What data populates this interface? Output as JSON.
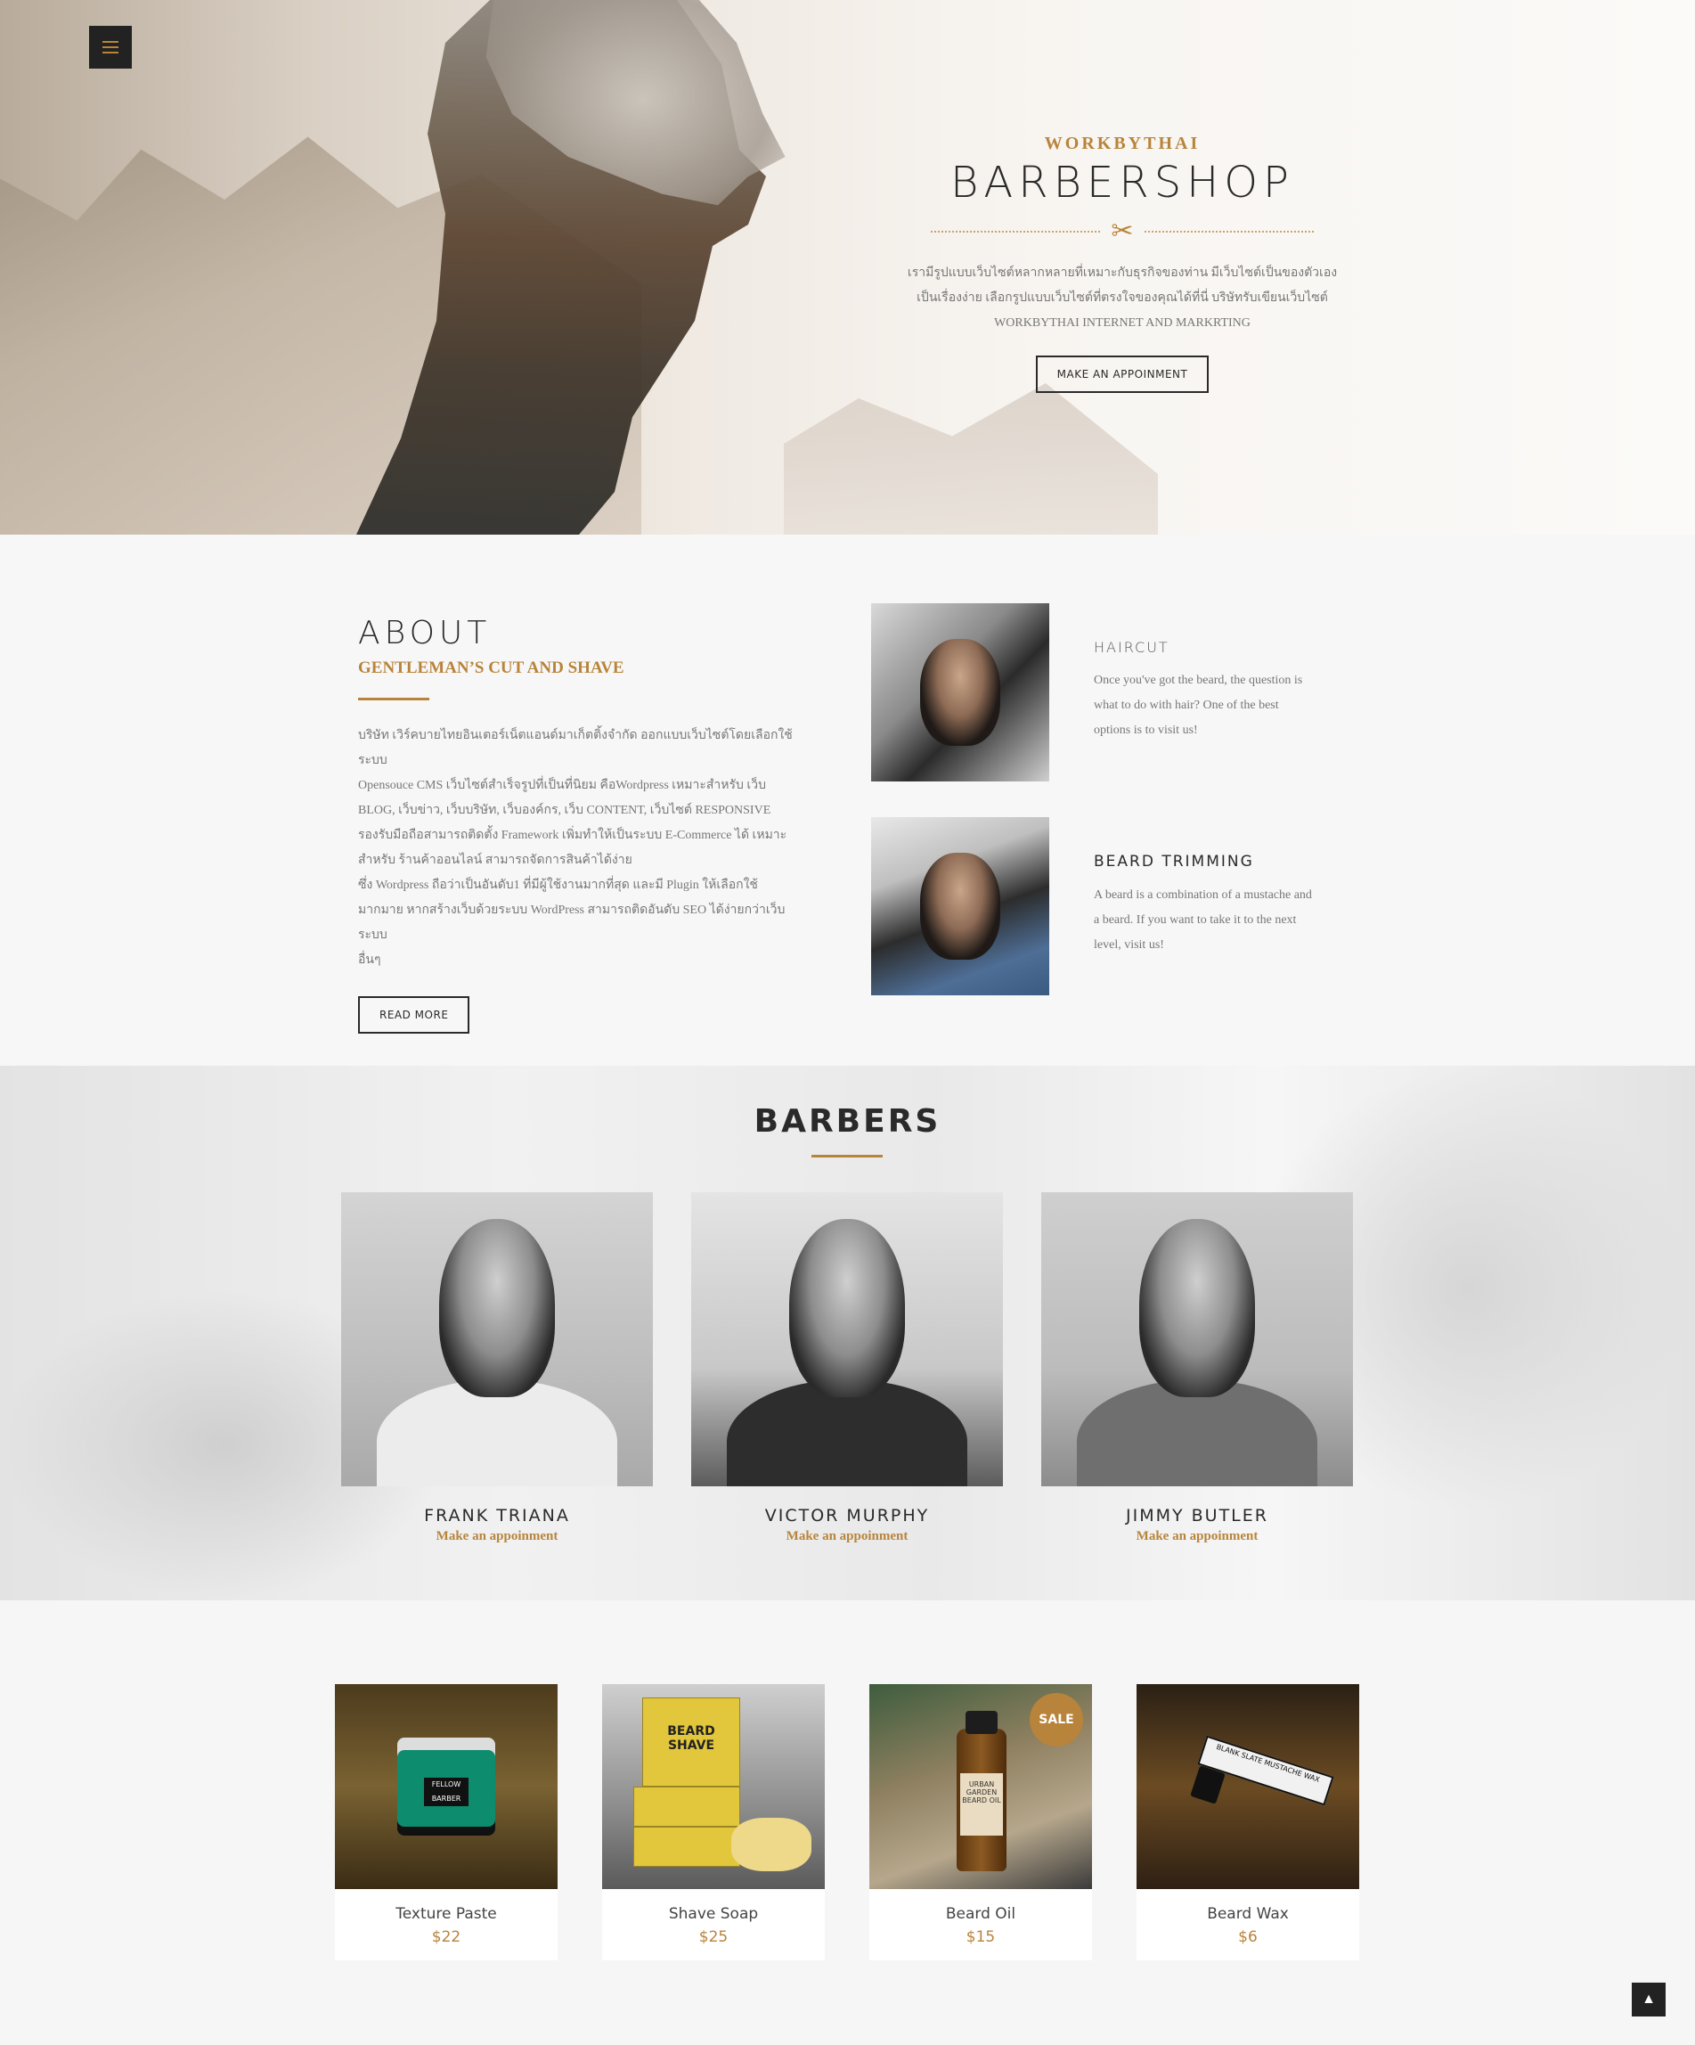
{
  "hero": {
    "brand": "WORKBYTHAI",
    "title": "BARBERSHOP",
    "desc_line1": "เรามีรูปแบบเว็บไซต์หลากหลายที่เหมาะกับธุรกิจของท่าน มีเว็บไซต์เป็นของตัวเอง",
    "desc_line2": "เป็นเรื่องง่าย เลือกรูปแบบเว็บไซต์ที่ตรงใจของคุณได้ที่นี่ บริษัทรับเขียนเว็บไซต์",
    "desc_line3": "WORKBYTHAI INTERNET AND MARKRTING",
    "cta": "MAKE AN APPOINMENT"
  },
  "about": {
    "title": "ABOUT",
    "subtitle": "GENTLEMAN’S CUT AND SHAVE",
    "body_lines": [
      "บริษัท เวิร์คบายไทยอินเตอร์เน็ตแอนด์มาเก็ตติ้งจำกัด ออกแบบเว็บไซต์โดยเลือกใช้ระบบ",
      "Opensouce CMS เว็บไซต์สำเร็จรูปที่เป็นที่นิยม คือWordpress เหมาะสำหรับ เว็บ",
      "BLOG, เว็บข่าว, เว็บบริษัท, เว็บองค์กร, เว็บ CONTENT, เว็บไซต์ RESPONSIVE",
      "รองรับมือถือสามารถติดตั้ง Framework เพิ่มทำให้เป็นระบบ E-Commerce ได้ เหมาะ",
      "สำหรับ ร้านค้าออนไลน์ สามารถจัดการสินค้าได้ง่าย",
      "ซึ่ง Wordpress ถือว่าเป็นอันดับ1 ที่มีผู้ใช้งานมากที่สุด และมี Plugin ให้เลือกใช้",
      "มากมาย หากสร้างเว็บด้วยระบบ WordPress สามารถติดอันดับ SEO ได้ง่ายกว่าเว็บระบบ",
      "อื่นๆ"
    ],
    "read_more": "READ MORE"
  },
  "services": [
    {
      "title": "HAIRCUT",
      "desc_lines": [
        "Once you've got the beard, the question is",
        "what to do with hair? One of the best",
        "options is to visit us!"
      ]
    },
    {
      "title": "BEARD TRIMMING",
      "desc_lines": [
        "A beard is a combination of a mustache and",
        "a beard. If you want to take it to the next",
        "level, visit us!"
      ]
    }
  ],
  "barbers": {
    "title": "BARBERS",
    "items": [
      {
        "name": "FRANK TRIANA",
        "link": "Make an appoinment"
      },
      {
        "name": "VICTOR MURPHY",
        "link": "Make an appoinment"
      },
      {
        "name": "JIMMY BUTLER",
        "link": "Make an appoinment"
      }
    ]
  },
  "products": [
    {
      "name": "Texture Paste",
      "price": "$22",
      "label": "FELLOW BARBER"
    },
    {
      "name": "Shave Soap",
      "price": "$25",
      "label": "BEARD SHAVE"
    },
    {
      "name": "Beard Oil",
      "price": "$15",
      "label": "URBAN GARDEN BEARD OIL",
      "badge": "SALE"
    },
    {
      "name": "Beard Wax",
      "price": "$6",
      "label": "BLANK SLATE MUSTACHE WAX"
    }
  ],
  "icons": {
    "menu": "hamburger-icon",
    "scissors": "scissors-icon",
    "to_top": "chevron-up-icon"
  },
  "colors": {
    "accent": "#b8843b",
    "dark": "#222222"
  }
}
